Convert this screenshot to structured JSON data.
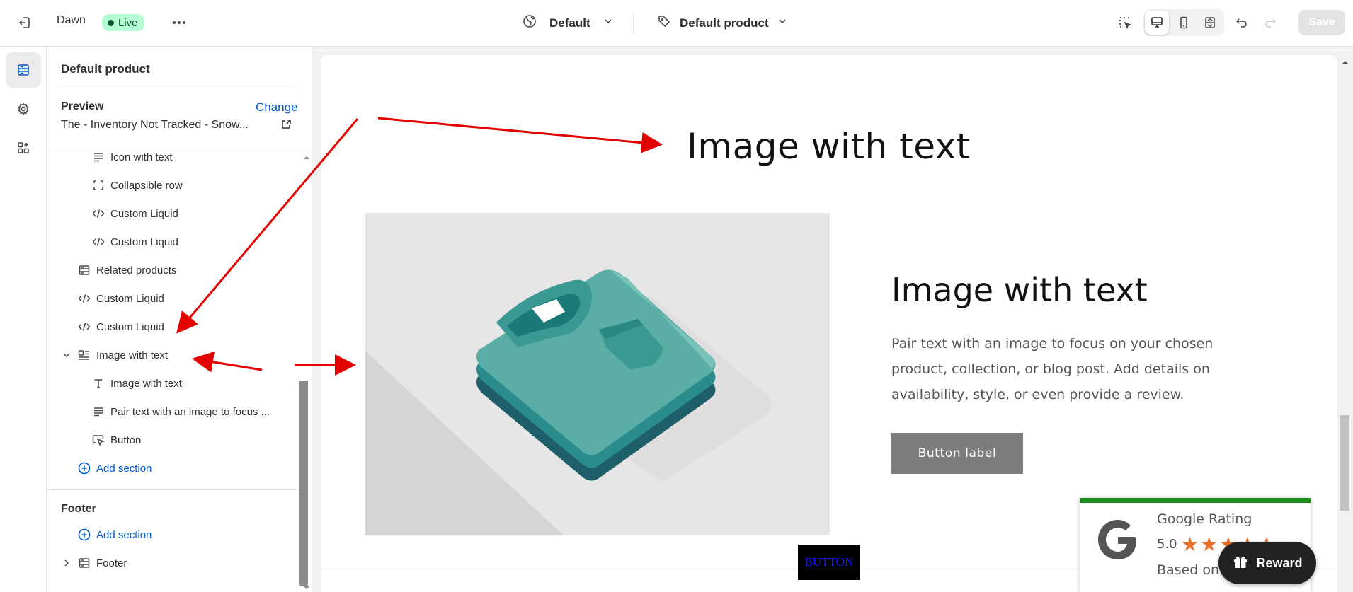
{
  "topbar": {
    "theme_name": "Dawn",
    "status": "Live",
    "template": "Default",
    "product": "Default product",
    "save_label": "Save"
  },
  "sidebar": {
    "title": "Default product",
    "preview_label": "Preview",
    "change_label": "Change",
    "preview_value": "The - Inventory Not Tracked - Snow...",
    "items": [
      {
        "label": "Icon with text",
        "icon": "text-lines-icon"
      },
      {
        "label": "Collapsible row",
        "icon": "collapsible-icon"
      },
      {
        "label": "Custom Liquid",
        "icon": "code-icon"
      },
      {
        "label": "Custom Liquid",
        "icon": "code-icon"
      },
      {
        "label": "Related products",
        "icon": "section-icon"
      },
      {
        "label": "Custom Liquid",
        "icon": "code-icon"
      },
      {
        "label": "Custom Liquid",
        "icon": "code-icon"
      },
      {
        "label": "Image with text",
        "icon": "image-text-icon"
      },
      {
        "label": "Image with text",
        "icon": "heading-icon"
      },
      {
        "label": "Pair text with an image to focus ...",
        "icon": "text-lines-icon"
      },
      {
        "label": "Button",
        "icon": "cursor-icon"
      },
      {
        "label": "Add section",
        "icon": "plus-circle-icon"
      }
    ],
    "footer_label": "Footer",
    "footer_add_section": "Add section",
    "footer_item": "Footer"
  },
  "preview": {
    "heading": "Image with text",
    "content_title": "Image with text",
    "content_body": "Pair text with an image to focus on your chosen product, collection, or blog post. Add details on availability, style, or even provide a review.",
    "button_label": "Button label",
    "black_button": "BUTTON"
  },
  "google_widget": {
    "title": "Google Rating",
    "score": "5.0",
    "stars": "★★★★★",
    "based_on": "Based on"
  },
  "reward": {
    "label": "Reward"
  },
  "colors": {
    "live_bg": "#b4fed2",
    "link": "#005bd3",
    "star": "#e8702a",
    "widget_accent": "#1a8f1a",
    "annotation": "#e50000"
  }
}
